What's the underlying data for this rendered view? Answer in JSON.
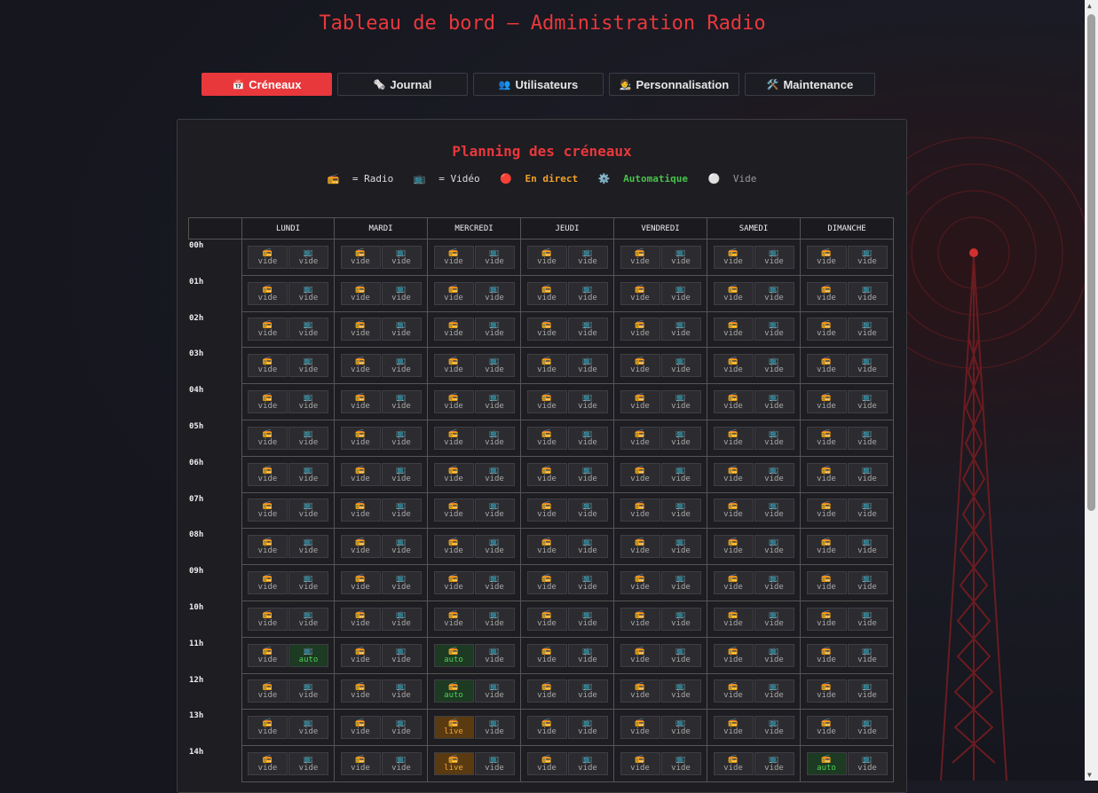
{
  "header": {
    "title": "Tableau de bord – Administration Radio"
  },
  "tabs": [
    {
      "icon": "📅",
      "label": "Créneaux",
      "active": true
    },
    {
      "icon": "🗞️",
      "label": "Journal",
      "active": false
    },
    {
      "icon": "👥",
      "label": "Utilisateurs",
      "active": false
    },
    {
      "icon": "🧑‍🎨",
      "label": "Personnalisation",
      "active": false
    },
    {
      "icon": "🛠️",
      "label": "Maintenance",
      "active": false
    }
  ],
  "planning": {
    "title": "Planning des créneaux",
    "legend": {
      "radio_icon": "📻",
      "radio_label": "= Radio",
      "video_icon": "📺",
      "video_label": "= Vidéo",
      "live_icon": "🔴",
      "live_label": "En direct",
      "auto_icon": "⚙️",
      "auto_label": "Automatique",
      "empty_icon": "⚪",
      "empty_label": "Vide"
    },
    "days": [
      "LUNDI",
      "MARDI",
      "MERCREDI",
      "JEUDI",
      "VENDREDI",
      "SAMEDI",
      "DIMANCHE"
    ],
    "hours": [
      "00h",
      "01h",
      "02h",
      "03h",
      "04h",
      "05h",
      "06h",
      "07h",
      "08h",
      "09h",
      "10h",
      "11h",
      "12h",
      "13h",
      "14h"
    ],
    "status_labels": {
      "empty": "vide",
      "auto": "auto",
      "live": "live"
    },
    "special_slots": [
      {
        "hour": "11h",
        "day": "LUNDI",
        "kind": "video",
        "status": "auto"
      },
      {
        "hour": "11h",
        "day": "MERCREDI",
        "kind": "radio",
        "status": "auto"
      },
      {
        "hour": "12h",
        "day": "MERCREDI",
        "kind": "radio",
        "status": "auto"
      },
      {
        "hour": "13h",
        "day": "MERCREDI",
        "kind": "radio",
        "status": "live"
      },
      {
        "hour": "14h",
        "day": "MERCREDI",
        "kind": "radio",
        "status": "live"
      },
      {
        "hour": "14h",
        "day": "DIMANCHE",
        "kind": "radio",
        "status": "auto"
      }
    ]
  },
  "colors": {
    "accent": "#e8383c",
    "live": "#f3a52e",
    "auto": "#4fd05a",
    "background": "#16171f"
  }
}
